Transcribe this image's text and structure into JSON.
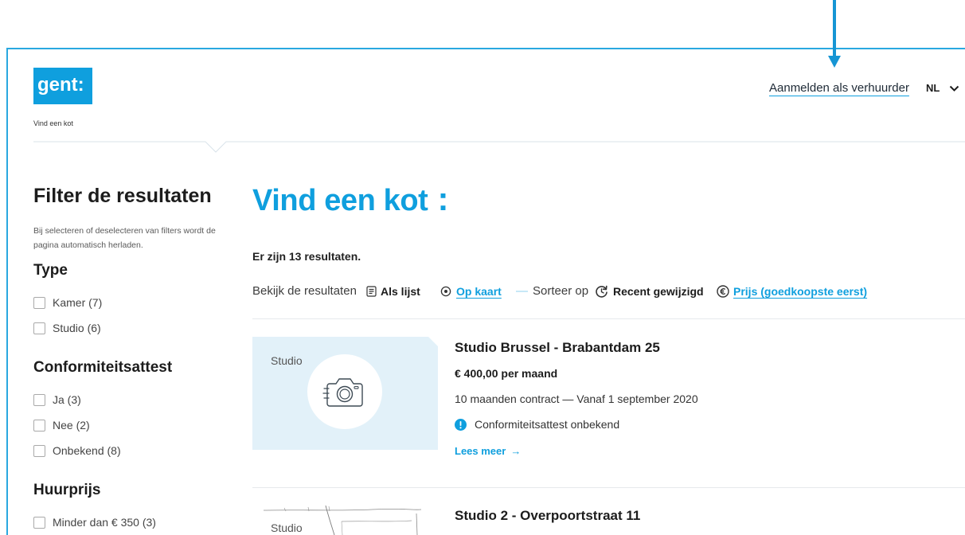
{
  "colors": {
    "brand_blue": "#0f9fde",
    "frame_border": "#2aa8e0",
    "annotation_arrow": "#1695d4",
    "image_placeholder": "#e2f1f9",
    "text": "#1f2328"
  },
  "header": {
    "logo_text": "gent:",
    "site_name": "Vind een kot",
    "login_link": "Aanmelden als verhuurder",
    "language": "NL",
    "language_icon": "chevron-down-icon"
  },
  "sidebar": {
    "title": "Filter de resultaten",
    "note": "Bij selecteren of deselecteren van filters wordt de pagina automatisch herladen.",
    "groups": [
      {
        "title": "Type",
        "options": [
          {
            "label": "Kamer (7)",
            "checked": false
          },
          {
            "label": "Studio (6)",
            "checked": false
          }
        ]
      },
      {
        "title": "Conformiteitsattest",
        "options": [
          {
            "label": "Ja (3)",
            "checked": false
          },
          {
            "label": "Nee (2)",
            "checked": false
          },
          {
            "label": "Onbekend (8)",
            "checked": false
          }
        ]
      },
      {
        "title": "Huurprijs",
        "options": [
          {
            "label": "Minder dan € 350 (3)",
            "checked": false
          }
        ]
      }
    ]
  },
  "main": {
    "title": "Vind een kot",
    "title_colon": ":",
    "results_count": "Er zijn 13 resultaten.",
    "view": {
      "label": "Bekijk de resultaten",
      "list": {
        "label": "Als lijst",
        "icon": "list-icon",
        "active": true
      },
      "map": {
        "label": "Op kaart",
        "icon": "location-icon",
        "active": false
      }
    },
    "separator": "—",
    "sort": {
      "label": "Sorteer op",
      "recent": {
        "label": "Recent gewijzigd",
        "icon": "recent-icon",
        "active": true
      },
      "price": {
        "label": "Prijs (goedkoopste eerst)",
        "icon": "euro-icon",
        "active": false
      }
    },
    "listings": [
      {
        "type": "Studio",
        "image_icon": "camera-icon",
        "title": "Studio Brussel - Brabantdam 25",
        "price": "€ 400,00 per maand",
        "contract": "10 maanden contract — Vanaf 1 september 2020",
        "attest": "Conformiteitsattest onbekend",
        "attest_icon": "alert-icon",
        "more_label": "Lees meer",
        "more_arrow": "→"
      },
      {
        "type": "Studio",
        "title": "Studio 2 - Overpoortstraat 11"
      }
    ]
  }
}
